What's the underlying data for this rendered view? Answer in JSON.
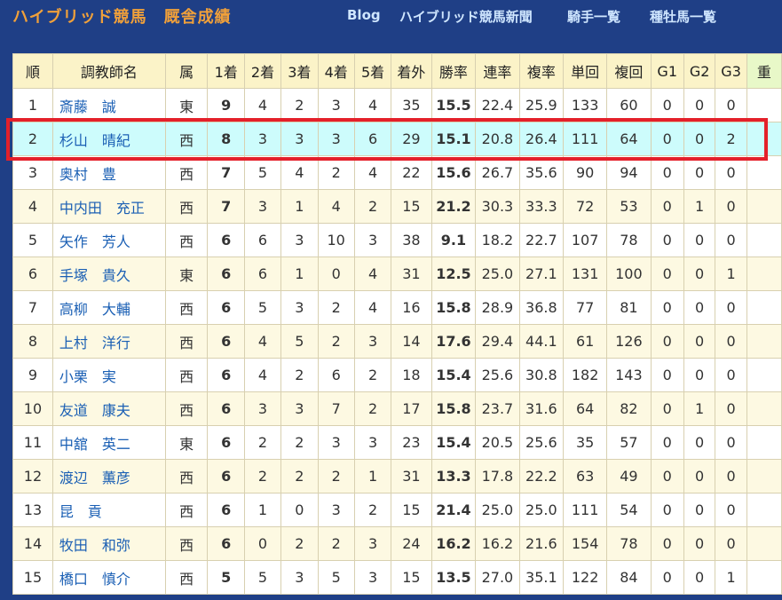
{
  "header": {
    "site_title": "ハイブリッド競馬　厩舎成績",
    "nav": [
      "Blog",
      "ハイブリッド競馬新聞",
      "騎手一覧",
      "種牡馬一覧"
    ]
  },
  "table": {
    "columns": [
      "順",
      "調教師名",
      "属",
      "1着",
      "2着",
      "3着",
      "4着",
      "5着",
      "着外",
      "勝率",
      "連率",
      "複率",
      "単回",
      "複回",
      "G1",
      "G2",
      "G3",
      "重"
    ],
    "rows": [
      [
        "1",
        "斎藤　誠",
        "東",
        "9",
        "4",
        "2",
        "3",
        "4",
        "35",
        "15.5",
        "22.4",
        "25.9",
        "133",
        "60",
        "0",
        "0",
        "0",
        ""
      ],
      [
        "2",
        "杉山　晴紀",
        "西",
        "8",
        "3",
        "3",
        "3",
        "6",
        "29",
        "15.1",
        "20.8",
        "26.4",
        "111",
        "64",
        "0",
        "0",
        "2",
        ""
      ],
      [
        "3",
        "奥村　豊",
        "西",
        "7",
        "5",
        "4",
        "2",
        "4",
        "22",
        "15.6",
        "26.7",
        "35.6",
        "90",
        "94",
        "0",
        "0",
        "0",
        ""
      ],
      [
        "4",
        "中内田　充正",
        "西",
        "7",
        "3",
        "1",
        "4",
        "2",
        "15",
        "21.2",
        "30.3",
        "33.3",
        "72",
        "53",
        "0",
        "1",
        "0",
        ""
      ],
      [
        "5",
        "矢作　芳人",
        "西",
        "6",
        "6",
        "3",
        "10",
        "3",
        "38",
        "9.1",
        "18.2",
        "22.7",
        "107",
        "78",
        "0",
        "0",
        "0",
        ""
      ],
      [
        "6",
        "手塚　貴久",
        "東",
        "6",
        "6",
        "1",
        "0",
        "4",
        "31",
        "12.5",
        "25.0",
        "27.1",
        "131",
        "100",
        "0",
        "0",
        "1",
        ""
      ],
      [
        "7",
        "高柳　大輔",
        "西",
        "6",
        "5",
        "3",
        "2",
        "4",
        "16",
        "15.8",
        "28.9",
        "36.8",
        "77",
        "81",
        "0",
        "0",
        "0",
        ""
      ],
      [
        "8",
        "上村　洋行",
        "西",
        "6",
        "4",
        "5",
        "2",
        "3",
        "14",
        "17.6",
        "29.4",
        "44.1",
        "61",
        "126",
        "0",
        "0",
        "0",
        ""
      ],
      [
        "9",
        "小栗　実",
        "西",
        "6",
        "4",
        "2",
        "6",
        "2",
        "18",
        "15.4",
        "25.6",
        "30.8",
        "182",
        "143",
        "0",
        "0",
        "0",
        ""
      ],
      [
        "10",
        "友道　康夫",
        "西",
        "6",
        "3",
        "3",
        "7",
        "2",
        "17",
        "15.8",
        "23.7",
        "31.6",
        "64",
        "82",
        "0",
        "1",
        "0",
        ""
      ],
      [
        "11",
        "中舘　英二",
        "東",
        "6",
        "2",
        "2",
        "3",
        "3",
        "23",
        "15.4",
        "20.5",
        "25.6",
        "35",
        "57",
        "0",
        "0",
        "0",
        ""
      ],
      [
        "12",
        "渡辺　薫彦",
        "西",
        "6",
        "2",
        "2",
        "2",
        "1",
        "31",
        "13.3",
        "17.8",
        "22.2",
        "63",
        "49",
        "0",
        "0",
        "0",
        ""
      ],
      [
        "13",
        "昆　貢",
        "西",
        "6",
        "1",
        "0",
        "3",
        "2",
        "15",
        "21.4",
        "25.0",
        "25.0",
        "111",
        "54",
        "0",
        "0",
        "0",
        ""
      ],
      [
        "14",
        "牧田　和弥",
        "西",
        "6",
        "0",
        "2",
        "2",
        "3",
        "24",
        "16.2",
        "16.2",
        "21.6",
        "154",
        "78",
        "0",
        "0",
        "0",
        ""
      ],
      [
        "15",
        "橋口　慎介",
        "西",
        "5",
        "5",
        "3",
        "5",
        "3",
        "15",
        "13.5",
        "27.0",
        "35.1",
        "122",
        "84",
        "0",
        "0",
        "1",
        ""
      ]
    ],
    "highlighted_row": "2"
  },
  "colors": {
    "page_bg": "#1f3f86",
    "title": "#f0a03a",
    "nav": "#cfe6ff",
    "header_bg": "#fbf3c8",
    "row_alt": "#fdf9e2",
    "row_highlight": "#cdfcfc",
    "link": "#1a5fb4",
    "highlight_box": "#e4202a"
  }
}
